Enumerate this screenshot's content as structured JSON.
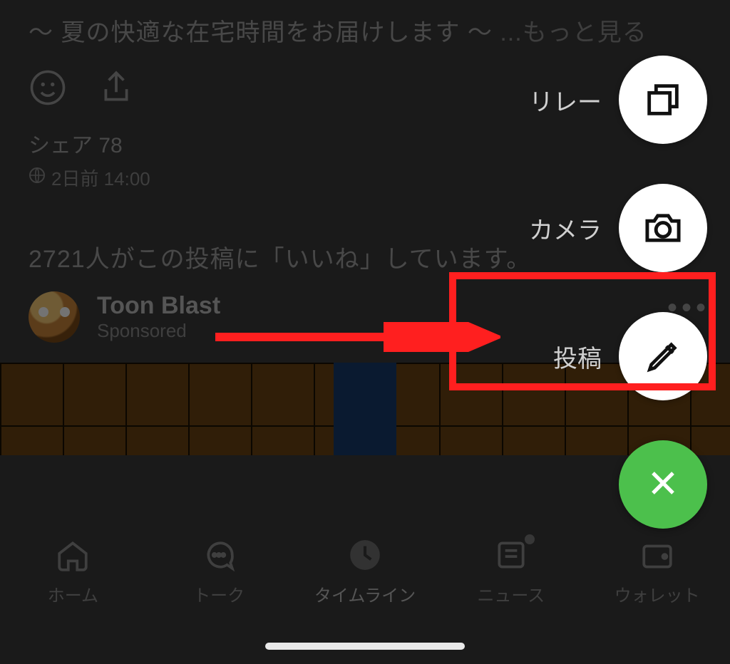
{
  "post": {
    "caption_prefix": "〜 夏の快適な在宅時間をお届けします 〜",
    "more": " ...もっと見る",
    "share_label": "シェア",
    "share_count": "78",
    "timestamp": "2日前 14:00",
    "likes_line": "2721人がこの投稿に「いいね」しています。"
  },
  "sponsored": {
    "name": "Toon Blast",
    "sub": "Sponsored"
  },
  "fab": {
    "relay": "リレー",
    "camera": "カメラ",
    "post": "投稿"
  },
  "tabs": {
    "home": "ホーム",
    "talk": "トーク",
    "timeline": "タイムライン",
    "news": "ニュース",
    "wallet": "ウォレット"
  }
}
